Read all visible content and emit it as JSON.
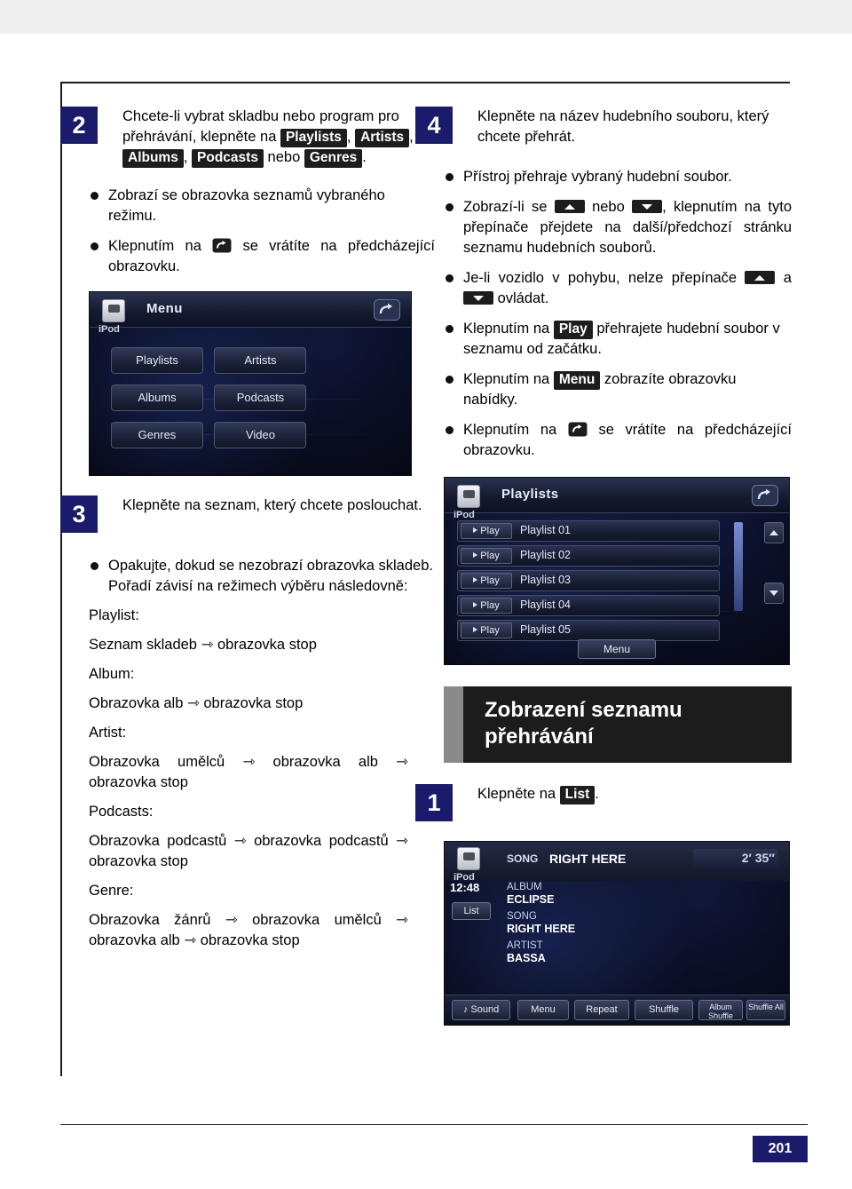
{
  "page": {
    "number": "201"
  },
  "left_column": {
    "step2": {
      "num": "2",
      "text_before": "Chcete-li vybrat skladbu nebo program pro přehrávání, klepněte na",
      "keys": [
        "Playlists",
        "Artists",
        "Albums",
        "Podcasts",
        "Genres"
      ],
      "sep_comma": ",",
      "sep_nebo": "nebo",
      "period": "."
    },
    "bullets": [
      {
        "text": "Zobrazí se obrazovka seznamů vybraného režimu."
      },
      {
        "text_a": "Klepnutím na",
        "icon": "back-arrow-icon",
        "text_b": "se vrátíte na předcházející obrazovku."
      }
    ],
    "menu_screenshot": {
      "device_label": "iPod",
      "title": "Menu",
      "back_icon": "back-arrow-icon",
      "buttons": [
        "Playlists",
        "Artists",
        "Albums",
        "Podcasts",
        "Genres",
        "Video"
      ]
    },
    "step3": {
      "num": "3",
      "text": "Klepněte na seznam, který chcete poslouchat."
    },
    "bullet_order": {
      "text": "Opakujte, dokud se nezobrazí obrazovka skladeb. Pořadí závisí na režimech výběru následovně:"
    },
    "order_list": [
      {
        "label": "Playlist:",
        "value": "Seznam skladeb ⇾ obrazovka stop"
      },
      {
        "label": "Album:",
        "value": "Obrazovka alb ⇾ obrazovka stop"
      },
      {
        "label": "Artist:",
        "value": "Obrazovka umělců ⇾ obrazovka alb ⇾ obrazovka stop"
      },
      {
        "label": "Podcasts:",
        "value": "Obrazovka podcastů ⇾ obrazovka podcastů ⇾ obrazovka stop"
      },
      {
        "label": "Genre:",
        "value": "Obrazovka žánrů ⇾ obrazovka umělců ⇾ obrazovka alb ⇾ obrazovka stop"
      }
    ]
  },
  "right_column": {
    "step4": {
      "num": "4",
      "text": "Klepněte na název hudebního souboru, který chcete přehrát."
    },
    "bullets": [
      {
        "id": "b1",
        "text": "Přístroj přehraje vybraný hudební soubor."
      },
      {
        "id": "b2",
        "t1": "Zobrazí-li se",
        "icon1": "switch-up-icon",
        "t2": "nebo",
        "icon2": "switch-down-icon",
        "t3": ", klepnutím na tyto přepínače přejdete na další/předchozí stránku seznamu hudebních souborů."
      },
      {
        "id": "b3",
        "t1": "Je-li vozidlo v pohybu, nelze přepínače",
        "icon1": "switch-up-icon",
        "t2": "a",
        "icon2": "switch-down-icon",
        "t3": "ovládat."
      },
      {
        "id": "b4",
        "t1": "Klepnutím na",
        "key": "Play",
        "t2": "přehrajete hudební soubor v seznamu od začátku."
      },
      {
        "id": "b5",
        "t1": "Klepnutím na",
        "key": "Menu",
        "t2": "zobrazíte obrazovku nabídky."
      },
      {
        "id": "b6",
        "t1": "Klepnutím na",
        "icon": "back-arrow-icon",
        "t2": "se vrátíte na předcházející obrazovku."
      }
    ],
    "playlists_screenshot": {
      "device_label": "iPod",
      "title": "Playlists",
      "back_icon": "back-arrow-icon",
      "rows": [
        {
          "play": "Play",
          "name": "Playlist 01"
        },
        {
          "play": "Play",
          "name": "Playlist 02"
        },
        {
          "play": "Play",
          "name": "Playlist 03"
        },
        {
          "play": "Play",
          "name": "Playlist 04"
        },
        {
          "play": "Play",
          "name": "Playlist 05"
        }
      ],
      "menu_label": "Menu",
      "scroll_up_icon": "arrow-up-icon",
      "scroll_down_icon": "arrow-down-icon"
    },
    "banner": {
      "line1": "Zobrazení seznamu",
      "line2": "přehrávání"
    },
    "step1": {
      "num": "1",
      "text_before": "Klepněte na",
      "key": "List",
      "period": "."
    },
    "nowplaying_screenshot": {
      "device_label": "iPod",
      "song_label": "SONG",
      "song_title": "RIGHT HERE",
      "time": "2′ 35″",
      "clock": "12:48",
      "list_button": "List",
      "meta": [
        {
          "label": "ALBUM",
          "value": "ECLIPSE"
        },
        {
          "label": "SONG",
          "value": "RIGHT HERE"
        },
        {
          "label": "ARTIST",
          "value": "BASSA"
        }
      ],
      "bottom_buttons": [
        "Sound",
        "Menu",
        "Repeat",
        "Shuffle",
        "Album Shuffle",
        "Shuffle All"
      ],
      "sound_icon": "music-note-icon"
    }
  }
}
